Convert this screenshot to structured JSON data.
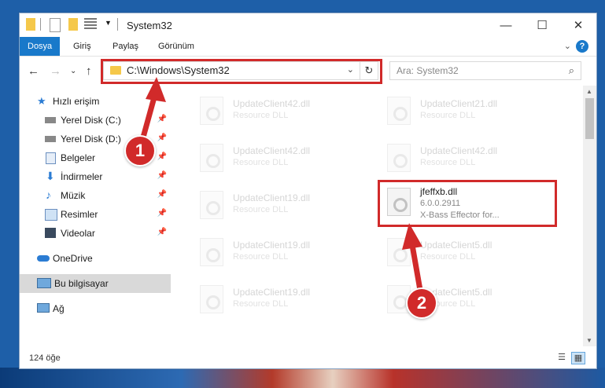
{
  "window": {
    "title": "System32"
  },
  "ribbon": {
    "tabs": [
      "Dosya",
      "Giriş",
      "Paylaş",
      "Görünüm"
    ],
    "help": "?"
  },
  "address": {
    "path": "C:\\Windows\\System32"
  },
  "search": {
    "placeholder": "Ara: System32"
  },
  "sidebar": {
    "items": [
      {
        "label": "Hızlı erişim"
      },
      {
        "label": "Yerel Disk (C:)"
      },
      {
        "label": "Yerel Disk (D:)"
      },
      {
        "label": "Belgeler"
      },
      {
        "label": "İndirmeler"
      },
      {
        "label": "Müzik"
      },
      {
        "label": "Resimler"
      },
      {
        "label": "Videolar"
      },
      {
        "label": "OneDrive"
      },
      {
        "label": "Bu bilgisayar"
      },
      {
        "label": "Ağ"
      }
    ]
  },
  "files": [
    {
      "name": "UpdateClient42.dll",
      "desc": "Resource DLL"
    },
    {
      "name": "UpdateClient21.dll",
      "desc": "Resource DLL"
    },
    {
      "name": "UpdateClient42.dll",
      "desc": "Resource DLL"
    },
    {
      "name": "UpdateClient42.dll",
      "desc": "Resource DLL"
    },
    {
      "name": "UpdateClient19.dll",
      "desc": "Resource DLL"
    },
    {
      "name": "UpdateClient19.dll",
      "desc": "Resource DLL"
    },
    {
      "name": "UpdateClient5.dll",
      "desc": "Resource DLL"
    },
    {
      "name": "UpdateClient19.dll",
      "desc": "Resource DLL"
    },
    {
      "name": "UpdateClient5.dll",
      "desc": "Resource DLL"
    }
  ],
  "highlight_file": {
    "name": "jfeffxb.dll",
    "version": "6.0.0.2911",
    "desc": "X-Bass Effector for..."
  },
  "status": {
    "count": "124 öğe"
  },
  "callouts": [
    "1",
    "2"
  ],
  "colors": {
    "accent": "#1979ca",
    "highlight": "#d12a2a"
  }
}
